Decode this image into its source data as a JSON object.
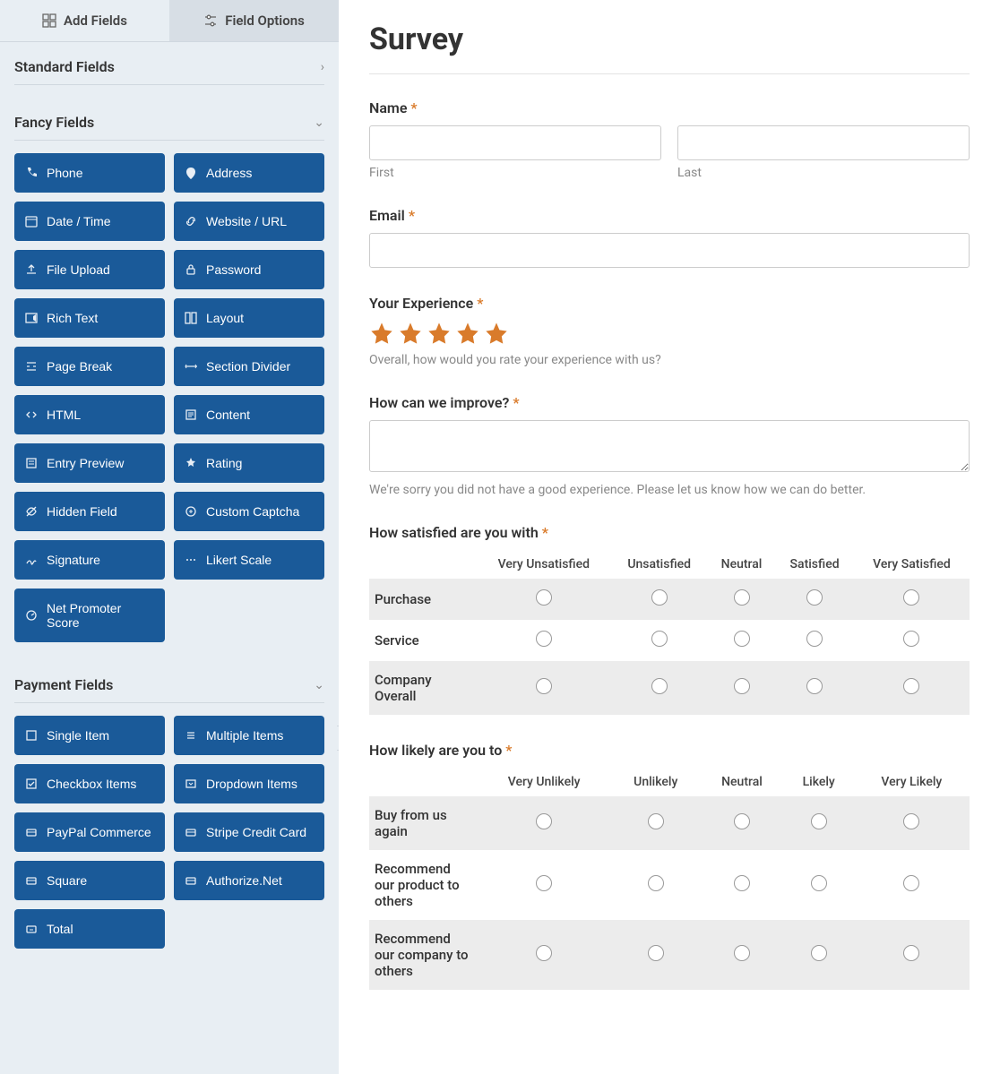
{
  "tabs": {
    "add_fields": "Add Fields",
    "field_options": "Field Options"
  },
  "sections": {
    "standard": {
      "title": "Standard Fields"
    },
    "fancy": {
      "title": "Fancy Fields",
      "items": [
        "Phone",
        "Address",
        "Date / Time",
        "Website / URL",
        "File Upload",
        "Password",
        "Rich Text",
        "Layout",
        "Page Break",
        "Section Divider",
        "HTML",
        "Content",
        "Entry Preview",
        "Rating",
        "Hidden Field",
        "Custom Captcha",
        "Signature",
        "Likert Scale",
        "Net Promoter Score"
      ]
    },
    "payment": {
      "title": "Payment Fields",
      "items": [
        "Single Item",
        "Multiple Items",
        "Checkbox Items",
        "Dropdown Items",
        "PayPal Commerce",
        "Stripe Credit Card",
        "Square",
        "Authorize.Net",
        "Total"
      ]
    }
  },
  "form": {
    "title": "Survey",
    "name": {
      "label": "Name",
      "first": "First",
      "last": "Last"
    },
    "email": {
      "label": "Email"
    },
    "experience": {
      "label": "Your Experience",
      "help": "Overall, how would you rate your experience with us?"
    },
    "improve": {
      "label": "How can we improve?",
      "help": "We're sorry you did not have a good experience. Please let us know how we can do better."
    },
    "satisfied": {
      "label": "How satisfied are you with",
      "cols": [
        "Very Unsatisfied",
        "Unsatisfied",
        "Neutral",
        "Satisfied",
        "Very Satisfied"
      ],
      "rows": [
        "Purchase",
        "Service",
        "Company Overall"
      ]
    },
    "likely": {
      "label": "How likely are you to",
      "cols": [
        "Very Unlikely",
        "Unlikely",
        "Neutral",
        "Likely",
        "Very Likely"
      ],
      "rows": [
        "Buy from us again",
        "Recommend our product to others",
        "Recommend our company to others"
      ]
    }
  }
}
